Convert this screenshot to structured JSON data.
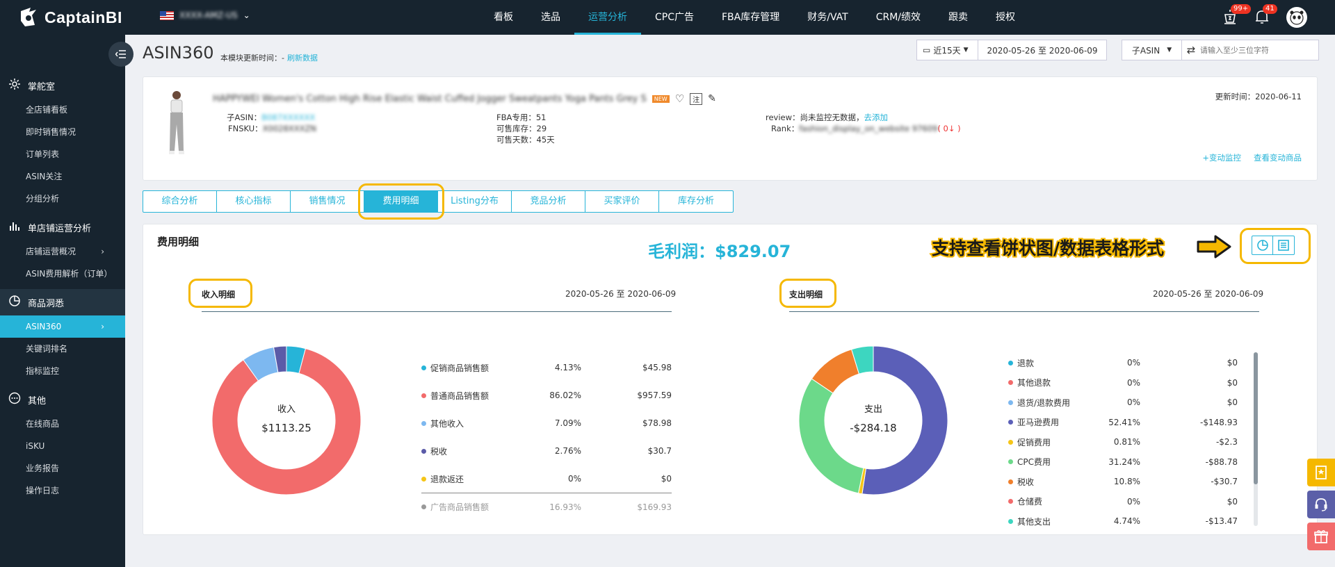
{
  "brand": {
    "name": "CaptainBI"
  },
  "store": {
    "name": "XXXX-AMZ-US"
  },
  "nav": [
    "看板",
    "选品",
    "运营分析",
    "CPC广告",
    "FBA库存管理",
    "财务/VAT",
    "CRM/绩效",
    "跟卖",
    "授权"
  ],
  "notifications": {
    "alerts": "99+",
    "bell": "41"
  },
  "sidebar": {
    "groups": [
      {
        "icon": "gear-icon",
        "label": "掌舵室",
        "items": [
          "全店铺看板",
          "即时销售情况",
          "订单列表",
          "ASIN关注",
          "分组分析"
        ]
      },
      {
        "icon": "bar-chart-icon",
        "label": "单店铺运营分析",
        "items": [
          "店铺运营概况",
          "ASIN费用解析（订单）"
        ]
      },
      {
        "icon": "pie-chart-icon",
        "label": "商品洞悉",
        "items": [
          "ASIN360",
          "关键词排名",
          "指标监控"
        ]
      },
      {
        "icon": "more-icon",
        "label": "其他",
        "items": [
          "在线商品",
          "iSKU",
          "业务报告",
          "操作日志"
        ]
      }
    ]
  },
  "header": {
    "title": "ASIN360",
    "updated_label": "本模块更新时间：-",
    "refresh": "刷新数据",
    "period": "近15天",
    "date_range": "2020-05-26 至 2020-06-09",
    "asin_type": "子ASIN",
    "search_placeholder": "请输入至少三位字符"
  },
  "product": {
    "title": "HAPPYWEI Women's Cotton High Rise Elastic Waist Cuffed Jogger Sweatpants Yoga Pants Grey S",
    "new_badge": "NEW",
    "note_icon_label": "注",
    "asin_label": "子ASIN：",
    "asin": "B087XXXXXX",
    "fnsku_label": "FNSKU：",
    "fnsku": "X0028XXXZN",
    "fba_label": "FBA专用：51",
    "stock_label": "可售库存：29",
    "days_label": "可售天数：45天",
    "review_label": "review：",
    "review_text": "尚未监控无数据，",
    "review_add": "去添加",
    "rank_label": "Rank：",
    "rank_value": "fashion_display_on_website 97609",
    "rank_change": "( 0↓ )",
    "update_time": "更新时间：2020-06-11",
    "monitor_link": "+变动监控",
    "view_changes": "查看变动商品"
  },
  "tabs": [
    "综合分析",
    "核心指标",
    "销售情况",
    "费用明细",
    "Listing分布",
    "竞品分析",
    "买家评价",
    "库存分析"
  ],
  "fee": {
    "section_title": "费用明细",
    "gross_profit": "毛利润：$829.07",
    "promo_text": "支持查看饼状图/数据表格形式"
  },
  "income": {
    "title": "收入明细",
    "date_range": "2020-05-26 至 2020-06-09",
    "center_label": "收入",
    "center_value": "$1113.25",
    "items": [
      {
        "name": "促销商品销售额",
        "pct": "4.13%",
        "value": "$45.98",
        "color": "#26b4d8"
      },
      {
        "name": "普通商品销售额",
        "pct": "86.02%",
        "value": "$957.59",
        "color": "#f26b6b"
      },
      {
        "name": "其他收入",
        "pct": "7.09%",
        "value": "$78.98",
        "color": "#7db8f0"
      },
      {
        "name": "税收",
        "pct": "2.76%",
        "value": "$30.7",
        "color": "#5b5ba8"
      },
      {
        "name": "退款返还",
        "pct": "0%",
        "value": "$0",
        "color": "#f5c518"
      }
    ],
    "ad_item": {
      "name": "广告商品销售额",
      "pct": "16.93%",
      "value": "$169.93",
      "color": "#999999"
    }
  },
  "expense": {
    "title": "支出明细",
    "date_range": "2020-05-26 至 2020-06-09",
    "center_label": "支出",
    "center_value": "-$284.18",
    "items": [
      {
        "name": "退款",
        "pct": "0%",
        "value": "$0",
        "color": "#26b4d8"
      },
      {
        "name": "其他退款",
        "pct": "0%",
        "value": "$0",
        "color": "#f26b6b"
      },
      {
        "name": "退货/退款费用",
        "pct": "0%",
        "value": "$0",
        "color": "#7db8f0"
      },
      {
        "name": "亚马逊费用",
        "pct": "52.41%",
        "value": "-$148.93",
        "color": "#5b5fb8"
      },
      {
        "name": "促销费用",
        "pct": "0.81%",
        "value": "-$2.3",
        "color": "#f5c518"
      },
      {
        "name": "CPC费用",
        "pct": "31.24%",
        "value": "-$88.78",
        "color": "#6cd98a"
      },
      {
        "name": "税收",
        "pct": "10.8%",
        "value": "-$30.7",
        "color": "#f07f2c"
      },
      {
        "name": "仓储费",
        "pct": "0%",
        "value": "$0",
        "color": "#f26b6b"
      },
      {
        "name": "其他支出",
        "pct": "4.74%",
        "value": "-$13.47",
        "color": "#3dd6c0"
      }
    ]
  },
  "chart_data": [
    {
      "type": "pie",
      "title": "收入明细",
      "categories": [
        "促销商品销售额",
        "普通商品销售额",
        "其他收入",
        "税收",
        "退款返还"
      ],
      "values": [
        4.13,
        86.02,
        7.09,
        2.76,
        0
      ],
      "colors": [
        "#26b4d8",
        "#f26b6b",
        "#7db8f0",
        "#5b5ba8",
        "#f5c518"
      ]
    },
    {
      "type": "pie",
      "title": "支出明细",
      "categories": [
        "退款",
        "其他退款",
        "退货/退款费用",
        "亚马逊费用",
        "促销费用",
        "CPC费用",
        "税收",
        "仓储费",
        "其他支出"
      ],
      "values": [
        0,
        0,
        0,
        52.41,
        0.81,
        31.24,
        10.8,
        0,
        4.74
      ],
      "colors": [
        "#26b4d8",
        "#f26b6b",
        "#7db8f0",
        "#5b5fb8",
        "#f5c518",
        "#6cd98a",
        "#f07f2c",
        "#f26b6b",
        "#3dd6c0"
      ]
    }
  ]
}
